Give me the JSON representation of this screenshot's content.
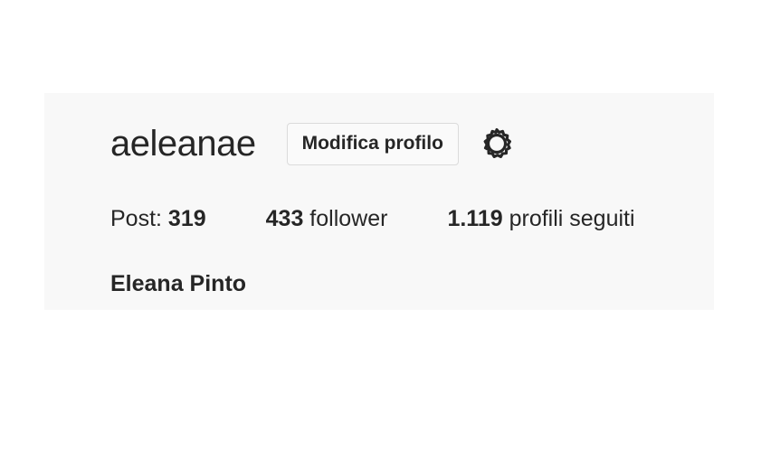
{
  "profile": {
    "username": "aeleanae",
    "edit_button_label": "Modifica profilo",
    "settings_icon": "gear-icon",
    "full_name": "Eleana Pinto"
  },
  "stats": {
    "posts_label": "Post: ",
    "posts_value": "319",
    "followers_value": "433",
    "followers_label": " follower",
    "following_value": "1.119",
    "following_label": " profili seguiti"
  },
  "colors": {
    "panel_background": "#f8f8f8",
    "text": "#262626",
    "button_border": "#dbdbdb"
  }
}
